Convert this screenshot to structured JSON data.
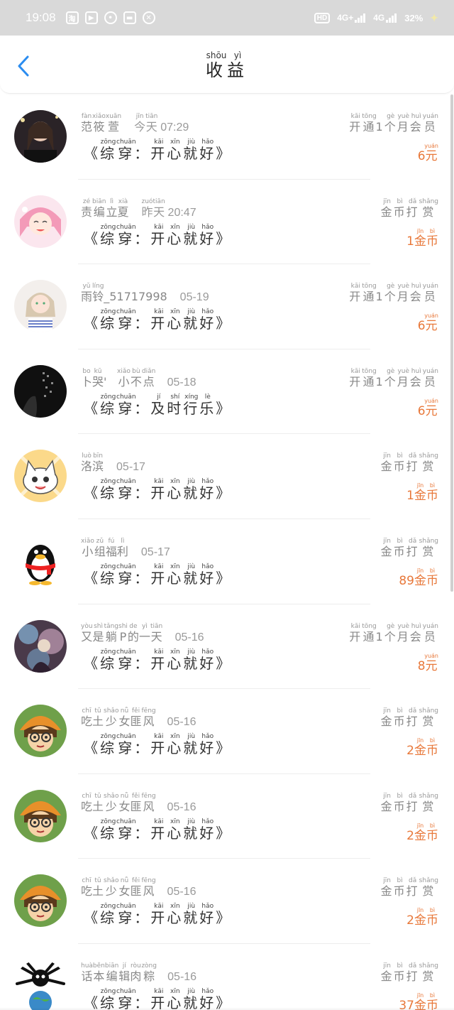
{
  "status_bar": {
    "time": "19:08",
    "icons": [
      "taobao-icon",
      "tencent-video-icon",
      "location-icon",
      "bank-card-icon",
      "fitness-icon"
    ],
    "hd_label": "HD",
    "network_1": "4G+",
    "network_2": "4G",
    "battery_text": "32%"
  },
  "header": {
    "title": [
      {
        "c": "收",
        "p": "shōu"
      },
      {
        "c": "益",
        "p": "yì"
      }
    ]
  },
  "colors": {
    "accent_blue": "#2b8df0",
    "amount_orange": "#e8783a"
  },
  "entries": [
    {
      "avatar": "avatar-girl-dark",
      "name": [
        {
          "c": "范",
          "p": "fàn"
        },
        {
          "c": "筱",
          "p": "xiǎo"
        },
        {
          "c": "萱",
          "p": "xuān"
        }
      ],
      "time": [
        {
          "c": "今",
          "p": "jīn"
        },
        {
          "c": "天",
          "p": "tiān"
        },
        {
          "t": " 07:29"
        }
      ],
      "book": [
        {
          "t": "《"
        },
        {
          "c": "综",
          "p": "zōng"
        },
        {
          "c": "穿",
          "p": "chuān"
        },
        {
          "t": "："
        },
        {
          "c": "开",
          "p": "kāi"
        },
        {
          "c": "心",
          "p": "xīn"
        },
        {
          "c": "就",
          "p": "jiù"
        },
        {
          "c": "好",
          "p": "hǎo"
        },
        {
          "t": "》"
        }
      ],
      "action": [
        {
          "c": "开",
          "p": "kāi"
        },
        {
          "c": "通",
          "p": "tōng"
        },
        {
          "t": "1"
        },
        {
          "c": "个",
          "p": "gè"
        },
        {
          "c": "月",
          "p": "yuè"
        },
        {
          "c": "会",
          "p": "huì"
        },
        {
          "c": "员",
          "p": "yuán"
        }
      ],
      "amount": [
        {
          "t": "6"
        },
        {
          "c": "元",
          "p": "yuán"
        }
      ]
    },
    {
      "avatar": "avatar-anime-pink",
      "name": [
        {
          "c": "责",
          "p": "zé"
        },
        {
          "c": "编",
          "p": "biān"
        },
        {
          "c": "立",
          "p": "lì"
        },
        {
          "c": "夏",
          "p": "xià"
        }
      ],
      "time": [
        {
          "c": "昨",
          "p": "zuó"
        },
        {
          "c": "天",
          "p": "tiān"
        },
        {
          "t": " 20:47"
        }
      ],
      "book": [
        {
          "t": "《"
        },
        {
          "c": "综",
          "p": "zōng"
        },
        {
          "c": "穿",
          "p": "chuān"
        },
        {
          "t": "："
        },
        {
          "c": "开",
          "p": "kāi"
        },
        {
          "c": "心",
          "p": "xīn"
        },
        {
          "c": "就",
          "p": "jiù"
        },
        {
          "c": "好",
          "p": "hǎo"
        },
        {
          "t": "》"
        }
      ],
      "action": [
        {
          "c": "金",
          "p": "jīn"
        },
        {
          "c": "币",
          "p": "bì"
        },
        {
          "c": "打",
          "p": "dǎ"
        },
        {
          "c": "赏",
          "p": "shǎng"
        }
      ],
      "amount": [
        {
          "t": "1"
        },
        {
          "c": "金",
          "p": "jīn"
        },
        {
          "c": "币",
          "p": "bì"
        }
      ]
    },
    {
      "avatar": "avatar-girl-light",
      "name": [
        {
          "c": "雨",
          "p": "yǔ"
        },
        {
          "c": "铃",
          "p": "líng"
        },
        {
          "t": "_51717998"
        }
      ],
      "time": [
        {
          "t": "05-19"
        }
      ],
      "book": [
        {
          "t": "《"
        },
        {
          "c": "综",
          "p": "zōng"
        },
        {
          "c": "穿",
          "p": "chuān"
        },
        {
          "t": "："
        },
        {
          "c": "开",
          "p": "kāi"
        },
        {
          "c": "心",
          "p": "xīn"
        },
        {
          "c": "就",
          "p": "jiù"
        },
        {
          "c": "好",
          "p": "hǎo"
        },
        {
          "t": "》"
        }
      ],
      "action": [
        {
          "c": "开",
          "p": "kāi"
        },
        {
          "c": "通",
          "p": "tōng"
        },
        {
          "t": "1"
        },
        {
          "c": "个",
          "p": "gè"
        },
        {
          "c": "月",
          "p": "yuè"
        },
        {
          "c": "会",
          "p": "huì"
        },
        {
          "c": "员",
          "p": "yuán"
        }
      ],
      "amount": [
        {
          "t": "6"
        },
        {
          "c": "元",
          "p": "yuán"
        }
      ]
    },
    {
      "avatar": "avatar-dark-text",
      "name": [
        {
          "c": "卜",
          "p": "bo"
        },
        {
          "c": "哭",
          "p": "kū"
        },
        {
          "t": "'　"
        },
        {
          "c": "小",
          "p": "xiǎo"
        },
        {
          "c": "不",
          "p": "bù"
        },
        {
          "c": "点",
          "p": "diǎn"
        }
      ],
      "time": [
        {
          "t": "05-18"
        }
      ],
      "book": [
        {
          "t": "《"
        },
        {
          "c": "综",
          "p": "zōng"
        },
        {
          "c": "穿",
          "p": "chuān"
        },
        {
          "t": "："
        },
        {
          "c": "及",
          "p": "jí"
        },
        {
          "c": "时",
          "p": "shí"
        },
        {
          "c": "行",
          "p": "xíng"
        },
        {
          "c": "乐",
          "p": "lè"
        },
        {
          "t": "》"
        }
      ],
      "action": [
        {
          "c": "开",
          "p": "kāi"
        },
        {
          "c": "通",
          "p": "tōng"
        },
        {
          "t": "1"
        },
        {
          "c": "个",
          "p": "gè"
        },
        {
          "c": "月",
          "p": "yuè"
        },
        {
          "c": "会",
          "p": "huì"
        },
        {
          "c": "员",
          "p": "yuán"
        }
      ],
      "amount": [
        {
          "t": "6"
        },
        {
          "c": "元",
          "p": "yuán"
        }
      ]
    },
    {
      "avatar": "avatar-cat",
      "name": [
        {
          "c": "洛",
          "p": "luò"
        },
        {
          "c": "滨",
          "p": "bīn"
        }
      ],
      "time": [
        {
          "t": "05-17"
        }
      ],
      "book": [
        {
          "t": "《"
        },
        {
          "c": "综",
          "p": "zōng"
        },
        {
          "c": "穿",
          "p": "chuān"
        },
        {
          "t": "："
        },
        {
          "c": "开",
          "p": "kāi"
        },
        {
          "c": "心",
          "p": "xīn"
        },
        {
          "c": "就",
          "p": "jiù"
        },
        {
          "c": "好",
          "p": "hǎo"
        },
        {
          "t": "》"
        }
      ],
      "action": [
        {
          "c": "金",
          "p": "jīn"
        },
        {
          "c": "币",
          "p": "bì"
        },
        {
          "c": "打",
          "p": "dǎ"
        },
        {
          "c": "赏",
          "p": "shǎng"
        }
      ],
      "amount": [
        {
          "t": "1"
        },
        {
          "c": "金",
          "p": "jīn"
        },
        {
          "c": "币",
          "p": "bì"
        }
      ]
    },
    {
      "avatar": "avatar-penguin",
      "name": [
        {
          "c": "小",
          "p": "xiǎo"
        },
        {
          "c": "组",
          "p": "zǔ"
        },
        {
          "c": "福",
          "p": "fú"
        },
        {
          "c": "利",
          "p": "lì"
        }
      ],
      "time": [
        {
          "t": "05-17"
        }
      ],
      "book": [
        {
          "t": "《"
        },
        {
          "c": "综",
          "p": "zōng"
        },
        {
          "c": "穿",
          "p": "chuān"
        },
        {
          "t": "："
        },
        {
          "c": "开",
          "p": "kāi"
        },
        {
          "c": "心",
          "p": "xīn"
        },
        {
          "c": "就",
          "p": "jiù"
        },
        {
          "c": "好",
          "p": "hǎo"
        },
        {
          "t": "》"
        }
      ],
      "action": [
        {
          "c": "金",
          "p": "jīn"
        },
        {
          "c": "币",
          "p": "bì"
        },
        {
          "c": "打",
          "p": "dǎ"
        },
        {
          "c": "赏",
          "p": "shǎng"
        }
      ],
      "amount": [
        {
          "t": "89"
        },
        {
          "c": "金",
          "p": "jīn"
        },
        {
          "c": "币",
          "p": "bì"
        }
      ]
    },
    {
      "avatar": "avatar-painting",
      "name": [
        {
          "c": "又",
          "p": "yòu"
        },
        {
          "c": "是",
          "p": "shì"
        },
        {
          "c": "躺",
          "p": "tǎng"
        },
        {
          "c": "P",
          "p": "shi"
        },
        {
          "c": "的",
          "p": "de"
        },
        {
          "c": "一",
          "p": "yì"
        },
        {
          "c": "天",
          "p": "tiān"
        }
      ],
      "time": [
        {
          "t": "05-16"
        }
      ],
      "book": [
        {
          "t": "《"
        },
        {
          "c": "综",
          "p": "zōng"
        },
        {
          "c": "穿",
          "p": "chuān"
        },
        {
          "t": "："
        },
        {
          "c": "开",
          "p": "kāi"
        },
        {
          "c": "心",
          "p": "xīn"
        },
        {
          "c": "就",
          "p": "jiù"
        },
        {
          "c": "好",
          "p": "hǎo"
        },
        {
          "t": "》"
        }
      ],
      "action": [
        {
          "c": "开",
          "p": "kāi"
        },
        {
          "c": "通",
          "p": "tōng"
        },
        {
          "t": "1"
        },
        {
          "c": "个",
          "p": "gè"
        },
        {
          "c": "月",
          "p": "yuè"
        },
        {
          "c": "会",
          "p": "huì"
        },
        {
          "c": "员",
          "p": "yuán"
        }
      ],
      "amount": [
        {
          "t": "8"
        },
        {
          "c": "元",
          "p": "yuán"
        }
      ]
    },
    {
      "avatar": "avatar-cartoon-kid",
      "name": [
        {
          "c": "吃",
          "p": "chī"
        },
        {
          "c": "土",
          "p": "tǔ"
        },
        {
          "c": "少",
          "p": "shǎo"
        },
        {
          "c": "女",
          "p": "nǚ"
        },
        {
          "c": "匪",
          "p": "fěi"
        },
        {
          "c": "风",
          "p": "fēng"
        }
      ],
      "time": [
        {
          "t": "05-16"
        }
      ],
      "book": [
        {
          "t": "《"
        },
        {
          "c": "综",
          "p": "zōng"
        },
        {
          "c": "穿",
          "p": "chuān"
        },
        {
          "t": "："
        },
        {
          "c": "开",
          "p": "kāi"
        },
        {
          "c": "心",
          "p": "xīn"
        },
        {
          "c": "就",
          "p": "jiù"
        },
        {
          "c": "好",
          "p": "hǎo"
        },
        {
          "t": "》"
        }
      ],
      "action": [
        {
          "c": "金",
          "p": "jīn"
        },
        {
          "c": "币",
          "p": "bì"
        },
        {
          "c": "打",
          "p": "dǎ"
        },
        {
          "c": "赏",
          "p": "shǎng"
        }
      ],
      "amount": [
        {
          "t": "2"
        },
        {
          "c": "金",
          "p": "jīn"
        },
        {
          "c": "币",
          "p": "bì"
        }
      ]
    },
    {
      "avatar": "avatar-cartoon-kid",
      "name": [
        {
          "c": "吃",
          "p": "chī"
        },
        {
          "c": "土",
          "p": "tǔ"
        },
        {
          "c": "少",
          "p": "shǎo"
        },
        {
          "c": "女",
          "p": "nǚ"
        },
        {
          "c": "匪",
          "p": "fěi"
        },
        {
          "c": "风",
          "p": "fēng"
        }
      ],
      "time": [
        {
          "t": "05-16"
        }
      ],
      "book": [
        {
          "t": "《"
        },
        {
          "c": "综",
          "p": "zōng"
        },
        {
          "c": "穿",
          "p": "chuān"
        },
        {
          "t": "："
        },
        {
          "c": "开",
          "p": "kāi"
        },
        {
          "c": "心",
          "p": "xīn"
        },
        {
          "c": "就",
          "p": "jiù"
        },
        {
          "c": "好",
          "p": "hǎo"
        },
        {
          "t": "》"
        }
      ],
      "action": [
        {
          "c": "金",
          "p": "jīn"
        },
        {
          "c": "币",
          "p": "bì"
        },
        {
          "c": "打",
          "p": "dǎ"
        },
        {
          "c": "赏",
          "p": "shǎng"
        }
      ],
      "amount": [
        {
          "t": "2"
        },
        {
          "c": "金",
          "p": "jīn"
        },
        {
          "c": "币",
          "p": "bì"
        }
      ]
    },
    {
      "avatar": "avatar-cartoon-kid",
      "name": [
        {
          "c": "吃",
          "p": "chī"
        },
        {
          "c": "土",
          "p": "tǔ"
        },
        {
          "c": "少",
          "p": "shǎo"
        },
        {
          "c": "女",
          "p": "nǚ"
        },
        {
          "c": "匪",
          "p": "fěi"
        },
        {
          "c": "风",
          "p": "fēng"
        }
      ],
      "time": [
        {
          "t": "05-16"
        }
      ],
      "book": [
        {
          "t": "《"
        },
        {
          "c": "综",
          "p": "zōng"
        },
        {
          "c": "穿",
          "p": "chuān"
        },
        {
          "t": "："
        },
        {
          "c": "开",
          "p": "kāi"
        },
        {
          "c": "心",
          "p": "xīn"
        },
        {
          "c": "就",
          "p": "jiù"
        },
        {
          "c": "好",
          "p": "hǎo"
        },
        {
          "t": "》"
        }
      ],
      "action": [
        {
          "c": "金",
          "p": "jīn"
        },
        {
          "c": "币",
          "p": "bì"
        },
        {
          "c": "打",
          "p": "dǎ"
        },
        {
          "c": "赏",
          "p": "shǎng"
        }
      ],
      "amount": [
        {
          "t": "2"
        },
        {
          "c": "金",
          "p": "jīn"
        },
        {
          "c": "币",
          "p": "bì"
        }
      ]
    },
    {
      "avatar": "avatar-octopus-earth",
      "name": [
        {
          "c": "话",
          "p": "huà"
        },
        {
          "c": "本",
          "p": "běn"
        },
        {
          "c": "编",
          "p": "biān"
        },
        {
          "c": "辑",
          "p": "jí"
        },
        {
          "c": "肉",
          "p": "ròu"
        },
        {
          "c": "粽",
          "p": "zòng"
        }
      ],
      "time": [
        {
          "t": "05-16"
        }
      ],
      "book": [
        {
          "t": "《"
        },
        {
          "c": "综",
          "p": "zōng"
        },
        {
          "c": "穿",
          "p": "chuān"
        },
        {
          "t": "："
        },
        {
          "c": "开",
          "p": "kāi"
        },
        {
          "c": "心",
          "p": "xīn"
        },
        {
          "c": "就",
          "p": "jiù"
        },
        {
          "c": "好",
          "p": "hǎo"
        },
        {
          "t": "》"
        }
      ],
      "action": [
        {
          "c": "金",
          "p": "jīn"
        },
        {
          "c": "币",
          "p": "bì"
        },
        {
          "c": "打",
          "p": "dǎ"
        },
        {
          "c": "赏",
          "p": "shǎng"
        }
      ],
      "amount": [
        {
          "t": "37"
        },
        {
          "c": "金",
          "p": "jīn"
        },
        {
          "c": "币",
          "p": "bì"
        }
      ]
    }
  ]
}
